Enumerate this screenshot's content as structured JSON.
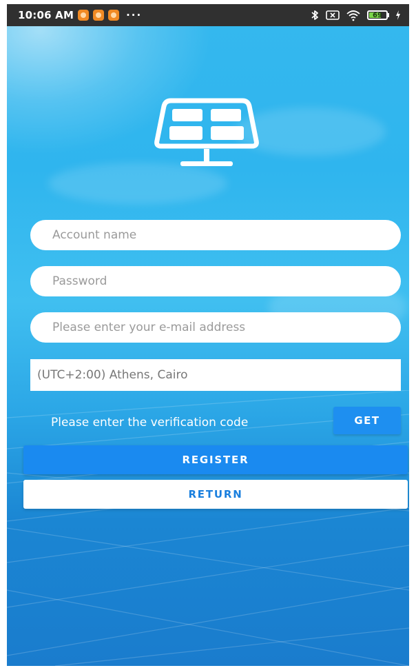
{
  "status_bar": {
    "time": "10:06 AM",
    "dots": "···",
    "battery_level": "69",
    "battery_fraction": 0.69
  },
  "form": {
    "account_placeholder": "Account name",
    "password_placeholder": "Password",
    "email_placeholder": "Please enter your e-mail address",
    "timezone_value": "(UTC+2:00) Athens, Cairo",
    "verification_label": "Please enter the verification code",
    "get_label": "GET"
  },
  "actions": {
    "register_label": "REGISTER",
    "return_label": "RETURN"
  },
  "icons": {
    "logo": "solar-panel-icon",
    "bluetooth": "bluetooth-icon",
    "sim": "no-sim-icon",
    "wifi": "wifi-icon",
    "battery": "battery-icon",
    "charging": "charging-icon"
  },
  "colors": {
    "primary_button": "#1a8af0",
    "return_text": "#1a7fde",
    "background_top": "#35b8ee",
    "background_bottom": "#1a7ccd"
  }
}
